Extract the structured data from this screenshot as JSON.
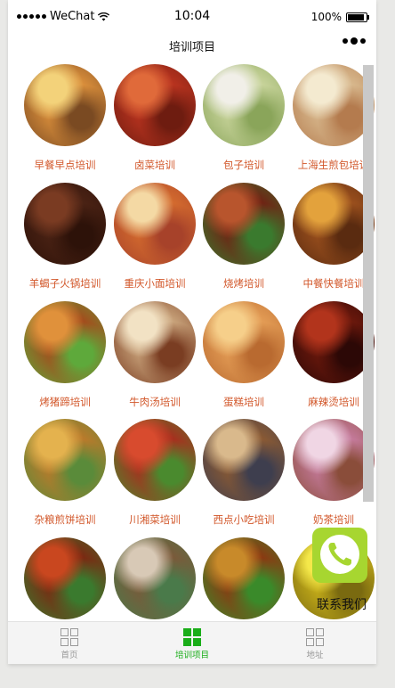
{
  "status_bar": {
    "carrier": "WeChat",
    "time": "10:04",
    "battery": "100%"
  },
  "navbar": {
    "title": "培训项目"
  },
  "items": [
    {
      "label": "早餐早点培训",
      "colors": [
        "#f3d27a",
        "#d98e3b",
        "#7a4a22"
      ]
    },
    {
      "label": "卤菜培训",
      "colors": [
        "#e06a3a",
        "#b8331f",
        "#6e1c10"
      ]
    },
    {
      "label": "包子培训",
      "colors": [
        "#f1efe8",
        "#c7d39a",
        "#8aa55a"
      ]
    },
    {
      "label": "上海生煎包培训",
      "colors": [
        "#f4ead0",
        "#d7b78c",
        "#b47b4e"
      ]
    },
    {
      "label": "羊蝎子火锅培训",
      "colors": [
        "#7a3b22",
        "#4a2214",
        "#2d1209"
      ]
    },
    {
      "label": "重庆小面培训",
      "colors": [
        "#f4d9a4",
        "#d36a2e",
        "#a7422a"
      ]
    },
    {
      "label": "烧烤培训",
      "colors": [
        "#b8552d",
        "#6e2414",
        "#3a7a2e"
      ]
    },
    {
      "label": "中餐快餐培训",
      "colors": [
        "#e3a23c",
        "#9a4f1d",
        "#5a2b10"
      ]
    },
    {
      "label": "烤猪蹄培训",
      "colors": [
        "#e0913b",
        "#a34d1d",
        "#5ea93b"
      ]
    },
    {
      "label": "牛肉汤培训",
      "colors": [
        "#f2e2c4",
        "#c8a27a",
        "#7a3d22"
      ]
    },
    {
      "label": "蛋糕培训",
      "colors": [
        "#f6cf8a",
        "#e39c55",
        "#b96a30"
      ]
    },
    {
      "label": "麻辣烫培训",
      "colors": [
        "#b2341c",
        "#6a180c",
        "#2c0806"
      ]
    },
    {
      "label": "杂粮煎饼培训",
      "colors": [
        "#e4b24e",
        "#b97a2b",
        "#5a8b3a"
      ]
    },
    {
      "label": "川湘菜培训",
      "colors": [
        "#d84b2e",
        "#a6301e",
        "#4a8a2e"
      ]
    },
    {
      "label": "西点小吃培训",
      "colors": [
        "#d9b98c",
        "#8a5a34",
        "#3e3e4e"
      ]
    },
    {
      "label": "奶茶培训",
      "colors": [
        "#f0d6e4",
        "#c47a9a",
        "#8a4d3a"
      ]
    },
    {
      "label": "",
      "colors": [
        "#c9471f",
        "#7a2a12",
        "#3a7a2e"
      ]
    },
    {
      "label": "",
      "colors": [
        "#d8c9b6",
        "#7a5a3a",
        "#4a7a4a"
      ]
    },
    {
      "label": "",
      "colors": [
        "#c88a2a",
        "#8a3a12",
        "#3a8a2a"
      ]
    },
    {
      "label": "",
      "colors": [
        "#f4e84a",
        "#c8b01a",
        "#7a6a10"
      ]
    }
  ],
  "fab": {
    "label": "联系我们",
    "icon": "phone-icon"
  },
  "tabbar": {
    "tabs": [
      {
        "label": "首页",
        "icon": "grid-icon"
      },
      {
        "label": "培训项目",
        "icon": "grid-icon"
      },
      {
        "label": "地址",
        "icon": "grid-icon"
      }
    ],
    "active_index": 1,
    "active_color": "#1aad19"
  }
}
